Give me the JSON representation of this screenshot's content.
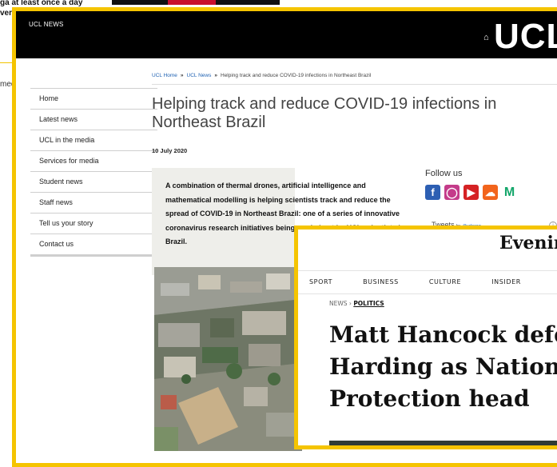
{
  "background": {
    "top_text_line1": "ga at least once a day",
    "top_text_line2": "ver",
    "side_text": "med"
  },
  "ucl": {
    "header_title": "UCL NEWS",
    "logo": "UCL",
    "nav": [
      "Home",
      "Latest news",
      "UCL in the media",
      "Services for media",
      "Student news",
      "Staff news",
      "Tell us your story",
      "Contact us"
    ],
    "breadcrumb": [
      "UCL Home",
      "UCL News",
      "Helping track and reduce COVID-19 infections in Northeast Brazil"
    ],
    "title": "Helping track and reduce COVID-19 infections in Northeast Brazil",
    "date": "10 July 2020",
    "summary": "A combination of thermal drones, artificial intelligence and mathematical modelling is helping scientists track and reduce the spread of COVID-19 in Northeast Brazil: one of a series of innovative coronavirus research initiatives being carried out by UCL scientists in Brazil.",
    "follow_label": "Follow us",
    "social_icons": [
      "facebook-icon",
      "instagram-icon",
      "youtube-icon",
      "soundcloud-icon",
      "medium-icon"
    ],
    "tweets_label": "Tweets",
    "tweets_by": "by",
    "tweets_handle": "@uclnews",
    "colors": {
      "accent_border": "#f5c400",
      "header_bg": "#000000",
      "link": "#1f62b3"
    }
  },
  "es": {
    "masthead": "Evening Standard",
    "nav": [
      "SPORT",
      "BUSINESS",
      "CULTURE",
      "INSIDER"
    ],
    "crumb_section": "NEWS",
    "crumb_sub": "POLITICS",
    "headline_lines": [
      "Matt Hancock defends Dido",
      "Harding as National Health",
      "Protection head"
    ]
  }
}
